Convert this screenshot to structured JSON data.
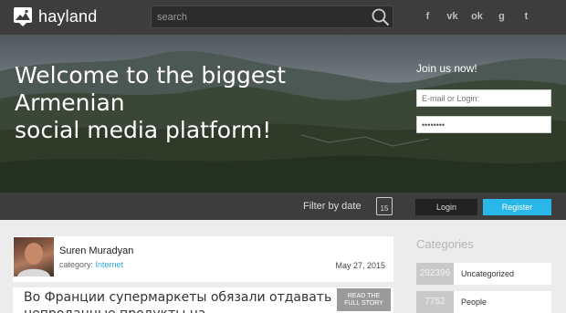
{
  "brand": {
    "name": "hayland",
    "logo_icon": "map-pin-icon"
  },
  "search": {
    "placeholder": "search",
    "value": "",
    "icon": "search-icon"
  },
  "socials": [
    {
      "label": "f",
      "icon": "facebook-icon"
    },
    {
      "label": "vk",
      "icon": "vk-icon"
    },
    {
      "label": "ok",
      "icon": "odnoklassniki-icon"
    },
    {
      "label": "g",
      "icon": "google-plus-icon"
    },
    {
      "label": "t",
      "icon": "twitter-icon"
    }
  ],
  "hero": {
    "headline_line1": "Welcome to the biggest",
    "headline_line2": "Armenian",
    "headline_line3": "social media platform!",
    "join_title": "Join us now!",
    "email_placeholder": "E-mail or Login:",
    "password_value": "••••••••"
  },
  "toolbar": {
    "filter_label": "Filter by date",
    "calendar_day": "15",
    "login_label": "Login",
    "register_label": "Register"
  },
  "post": {
    "author": "Suren Muradyan",
    "category_prefix": "category:",
    "category": "Internet",
    "date": "May 27, 2015",
    "title": "Во Франции супермаркеты обязали отдавать непроданные продукты на",
    "read_button_line1": "READ THE",
    "read_button_line2": "FULL STORY"
  },
  "categories": {
    "title": "Categories",
    "items": [
      {
        "count": "292396",
        "name": "Uncategorized"
      },
      {
        "count": "7752",
        "name": "People"
      }
    ]
  },
  "colors": {
    "accent": "#29b6e8",
    "topbar": "#3d3d3d",
    "background": "#ececec"
  }
}
